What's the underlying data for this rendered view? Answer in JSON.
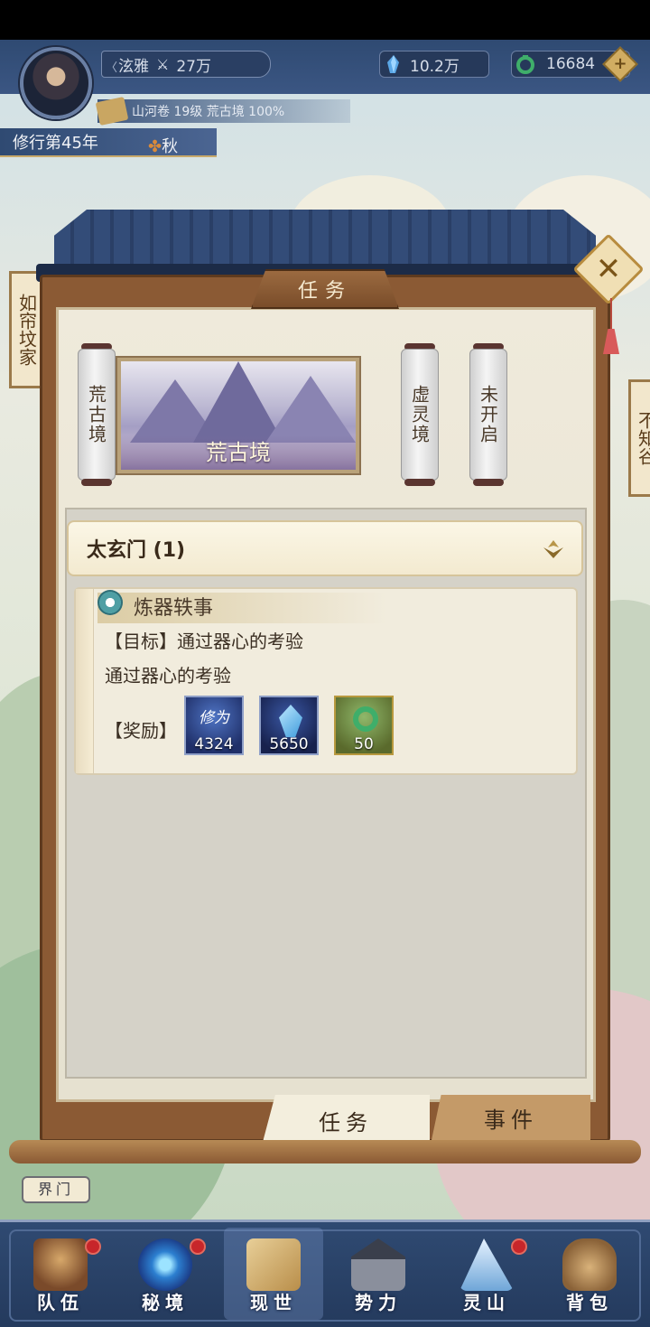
{
  "hud": {
    "player_name": "泫雅",
    "power": "27万",
    "spirit_stones": "10.2万",
    "jade": "16684",
    "add_label": "+",
    "progress_text": "山河卷 19级 荒古境 100%",
    "year_text": "修行第45年",
    "season": "秋"
  },
  "side": {
    "left_scroll": "如帘坟家",
    "right_scroll": "不知谷"
  },
  "panel": {
    "title": "任务",
    "close_label": "✕",
    "realms": [
      {
        "label": "荒古境"
      },
      {
        "label": "虚灵境"
      },
      {
        "label": "未开启"
      }
    ],
    "selected_realm_label": "荒古境",
    "section": {
      "name": "太玄门 (1)"
    },
    "quest": {
      "title": "炼器轶事",
      "goal": "【目标】通过器心的考验",
      "description": "通过器心的考验",
      "reward_label": "【奖励】",
      "rewards": [
        {
          "name": "修为",
          "count": "4324"
        },
        {
          "name": "灵石",
          "count": "5650"
        },
        {
          "name": "玉",
          "count": "50"
        }
      ]
    },
    "tabs": {
      "quest": "任务",
      "event": "事件"
    }
  },
  "gate_label": "界门",
  "nav": [
    {
      "label": "队伍",
      "badge": true
    },
    {
      "label": "秘境",
      "badge": true
    },
    {
      "label": "现世",
      "badge": false
    },
    {
      "label": "势力",
      "badge": false
    },
    {
      "label": "灵山",
      "badge": true
    },
    {
      "label": "背包",
      "badge": false
    }
  ]
}
